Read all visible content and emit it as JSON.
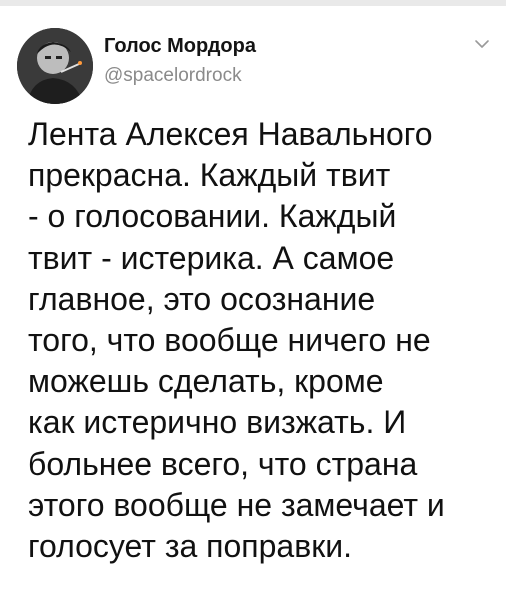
{
  "tweet": {
    "author": {
      "display_name": "Голос Мордора",
      "handle": "@spacelordrock",
      "avatar_icon": "avatar-portrait"
    },
    "menu_icon": "chevron-down-icon",
    "text_lines": [
      "Лента Алексея Навального",
      "прекрасна. Каждый твит",
      "- о голосовании. Каждый",
      "твит - истерика. А самое",
      "главное, это осознание",
      "того, что вообще ничего не",
      "можешь сделать, кроме",
      "как истерично визжать. И",
      "больнее всего, что страна",
      "этого вообще не замечает и",
      "голосует за поправки."
    ]
  }
}
